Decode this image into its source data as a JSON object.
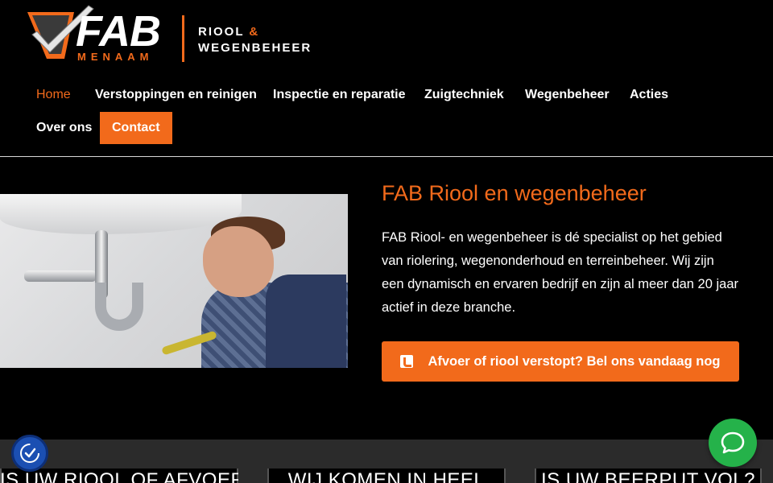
{
  "logo": {
    "wordmark": "FAB",
    "tagline": "MENAAM",
    "line1_a": "RIOOL",
    "line1_amp": "&",
    "line2": "WEGENBEHEER"
  },
  "nav": {
    "items": [
      {
        "label": "Home",
        "active": true
      },
      {
        "label": "Verstoppingen en reinigen"
      },
      {
        "label": "Inspectie en reparatie"
      },
      {
        "label": "Zuigtechniek"
      },
      {
        "label": "Wegenbeheer"
      },
      {
        "label": "Acties"
      },
      {
        "label": "Over ons"
      },
      {
        "label": "Contact"
      }
    ]
  },
  "hero": {
    "title": "FAB Riool en wegenbeheer",
    "text": "FAB Riool- en wegenbeheer is dé specialist op het gebied van riolering, wegenonderhoud en terreinbeheer. Wij zijn een dynamisch en ervaren bedrijf en zijn al meer dan 20 jaar actief in deze branche.",
    "cta_label": "Afvoer of riool verstopt? Bel ons vandaag nog"
  },
  "cards": [
    {
      "title": "IS UW RIOOL OF AFVOER"
    },
    {
      "title": "WIJ KOMEN IN HEEL"
    },
    {
      "title": "IS UW BEERPUT VOL?"
    }
  ],
  "colors": {
    "accent": "#f26a1b",
    "background": "#000000",
    "chat": "#25b24a",
    "accessibility": "#1b4fb2"
  },
  "icons": {
    "cta": "phone-square-icon",
    "chat": "chat-bubble-icon",
    "accessibility": "accessibility-icon"
  }
}
